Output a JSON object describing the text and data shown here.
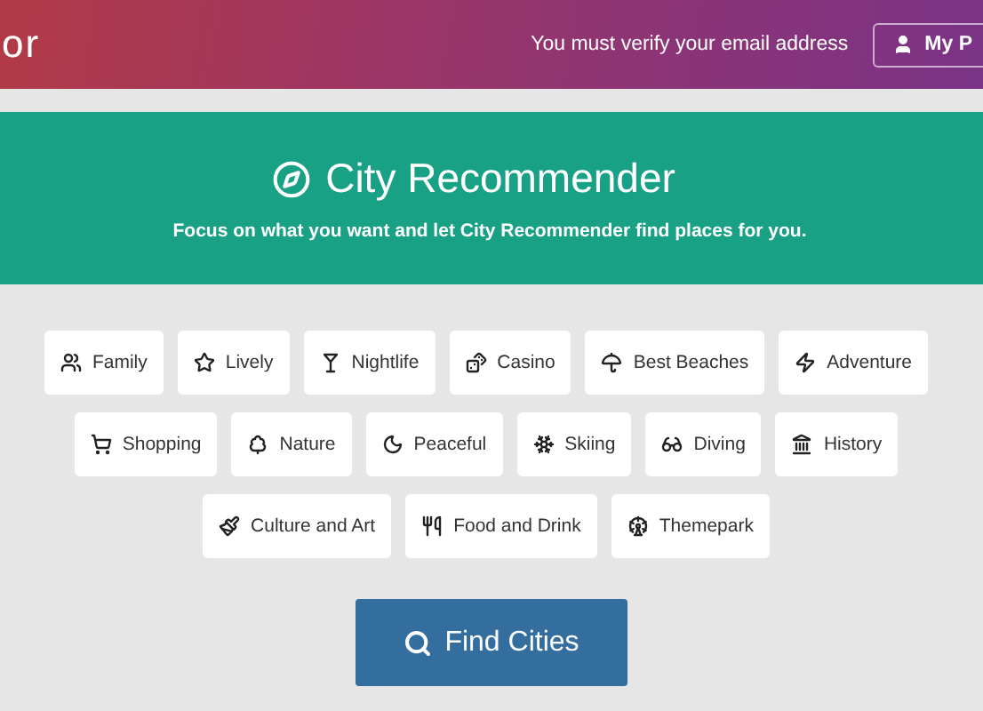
{
  "header": {
    "brand": "or",
    "notice": "You must verify your email address",
    "account_button": "My P"
  },
  "hero": {
    "title": "City Recommender",
    "subtitle": "Focus on what you want and let City Recommender find places for you."
  },
  "tag_rows": [
    [
      "Family",
      "Lively",
      "Nightlife",
      "Casino",
      "Best Beaches",
      "Adventure"
    ],
    [
      "Shopping",
      "Nature",
      "Peaceful",
      "Skiing",
      "Diving",
      "History"
    ],
    [
      "Culture and Art",
      "Food and Drink",
      "Themepark"
    ]
  ],
  "search_button": "Find Cities"
}
